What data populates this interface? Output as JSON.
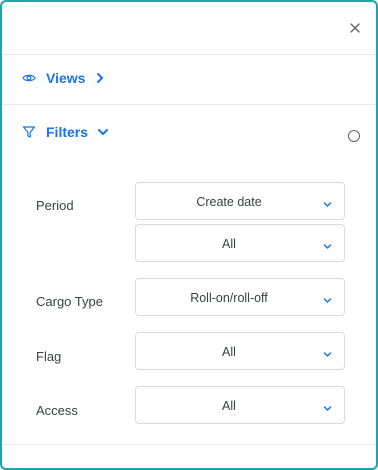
{
  "panel": {
    "close_icon": "close-icon"
  },
  "views": {
    "label": "Views",
    "icon": "eye-icon",
    "chevron": "chevron-right-icon"
  },
  "filters": {
    "label": "Filters",
    "icon": "funnel-icon",
    "chevron": "chevron-down-icon",
    "fields": {
      "period": {
        "label": "Period",
        "date_type": "Create date",
        "range": "All"
      },
      "cargo_type": {
        "label": "Cargo Type",
        "value": "Roll-on/roll-off"
      },
      "flag": {
        "label": "Flag",
        "value": "All"
      },
      "access": {
        "label": "Access",
        "value": "All"
      }
    }
  },
  "colors": {
    "accent": "#1a73e8",
    "frame_border": "#1aa6ad",
    "divider": "#e4e7eb"
  }
}
